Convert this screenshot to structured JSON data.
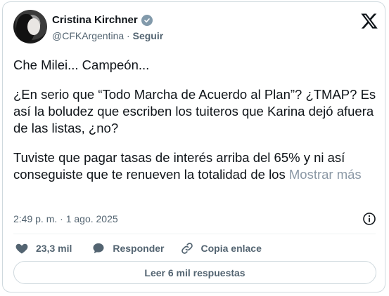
{
  "author": {
    "name": "Cristina Kirchner",
    "handle": "@CFKArgentina",
    "separator": "·",
    "follow_label": "Seguir"
  },
  "tweet": {
    "paragraphs": [
      "Che Milei... Campeón...",
      "¿En serio que “Todo Marcha de Acuerdo al Plan”? ¿TMAP? Es así la boludez que escriben los tuiteros que Karina dejó afuera de las listas, ¿no?"
    ],
    "last_paragraph": "Tuviste que pagar tasas de interés arriba del 65% y ni así conseguiste que te renueven la totalidad de los",
    "show_more_label": "Mostrar más",
    "timestamp": "2:49 p. m. · 1 ago. 2025"
  },
  "actions": {
    "likes_count": "23,3 mil",
    "reply_label": "Responder",
    "copy_link_label": "Copia enlace"
  },
  "read_replies_label": "Leer 6 mil respuestas",
  "colors": {
    "text": "#0f1419",
    "secondary": "#536471",
    "border": "#cfd9de",
    "verified_badge": "#829aab"
  }
}
